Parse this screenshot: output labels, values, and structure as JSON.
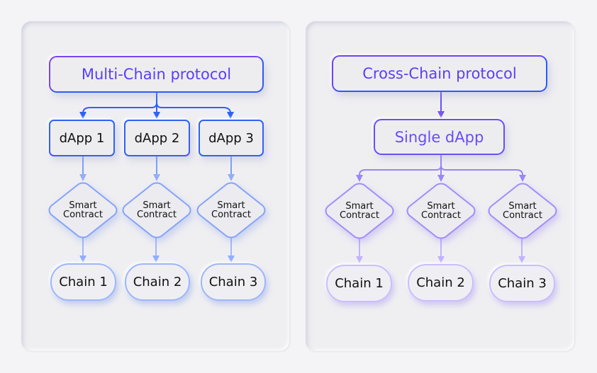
{
  "colors": {
    "background": "#f4f4f6",
    "panel": "#efeff2",
    "blue_accent": "#2f62f5",
    "purple_accent": "#7a55f5",
    "light_blue": "#8fabf8",
    "light_purple": "#b9a6fb",
    "title_text": "#5b3ff2",
    "dapp_text_purple": "#6a4df2"
  },
  "left": {
    "title": "Multi-Chain protocol",
    "dapps": [
      {
        "label": "dApp 1"
      },
      {
        "label": "dApp 2"
      },
      {
        "label": "dApp 3"
      }
    ],
    "contracts": [
      {
        "line1": "Smart",
        "line2": "Contract"
      },
      {
        "line1": "Smart",
        "line2": "Contract"
      },
      {
        "line1": "Smart",
        "line2": "Contract"
      }
    ],
    "chains": [
      {
        "label": "Chain 1"
      },
      {
        "label": "Chain 2"
      },
      {
        "label": "Chain 3"
      }
    ]
  },
  "right": {
    "title": "Cross-Chain protocol",
    "dapp": "Single dApp",
    "contracts": [
      {
        "line1": "Smart",
        "line2": "Contract"
      },
      {
        "line1": "Smart",
        "line2": "Contract"
      },
      {
        "line1": "Smart",
        "line2": "Contract"
      }
    ],
    "chains": [
      {
        "label": "Chain 1"
      },
      {
        "label": "Chain 2"
      },
      {
        "label": "Chain 3"
      }
    ]
  }
}
